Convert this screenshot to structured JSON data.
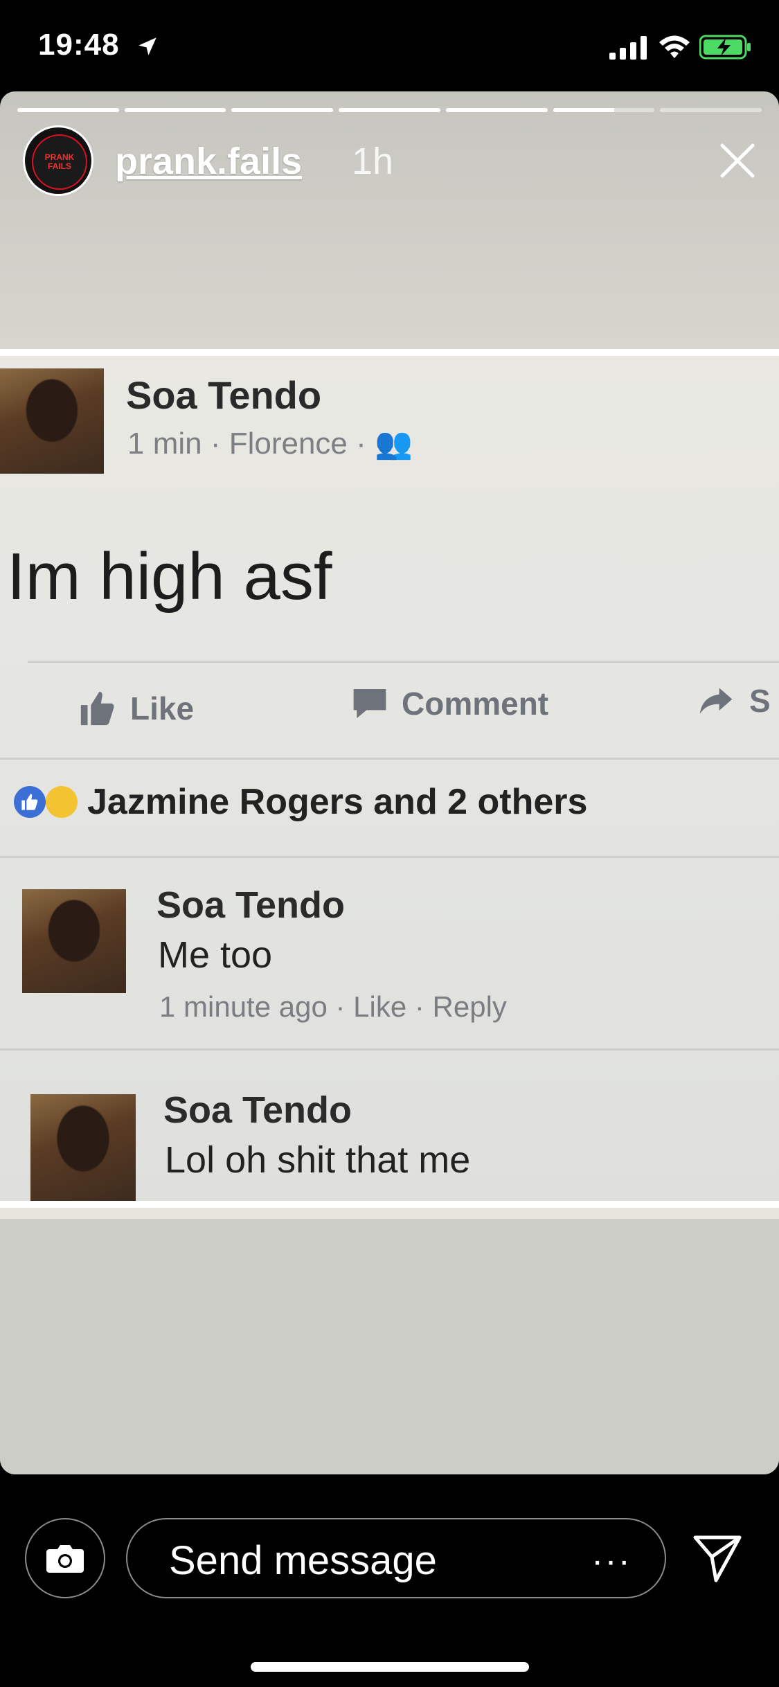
{
  "status_bar": {
    "time": "19:48",
    "icons": [
      "location-arrow-icon",
      "cellular-signal-icon",
      "wifi-icon",
      "battery-charging-icon"
    ],
    "battery_color": "#4cd964"
  },
  "story": {
    "segments_total": 7,
    "segments_complete": 5,
    "current_segment_progress": 0.6,
    "username": "prank.fails",
    "time_ago": "1h",
    "avatar_text": [
      "PRANK",
      "FAILS"
    ],
    "close_icon": "close-icon"
  },
  "post": {
    "author": "Soa Tendo",
    "meta": "1 min · Florence · 👥",
    "text": "Im high asf",
    "actions": {
      "like": "Like",
      "comment": "Comment",
      "share": "S"
    },
    "reactions": {
      "icons": [
        "like-reaction-icon",
        "haha-reaction-icon"
      ],
      "text": "Jazmine Rogers and 2 others"
    },
    "comments": [
      {
        "name": "Soa Tendo",
        "text": "Me too",
        "meta": "1 minute ago · Like · Reply"
      },
      {
        "name": "Soa Tendo",
        "text": "Lol oh shit that me",
        "meta": ""
      }
    ]
  },
  "footer": {
    "placeholder": "Send message",
    "more": "···",
    "icons": [
      "camera-icon",
      "more-icon",
      "send-icon"
    ]
  },
  "colors": {
    "accent_blue": "#3b6fd6",
    "meta_gray": "#7c7f84"
  }
}
